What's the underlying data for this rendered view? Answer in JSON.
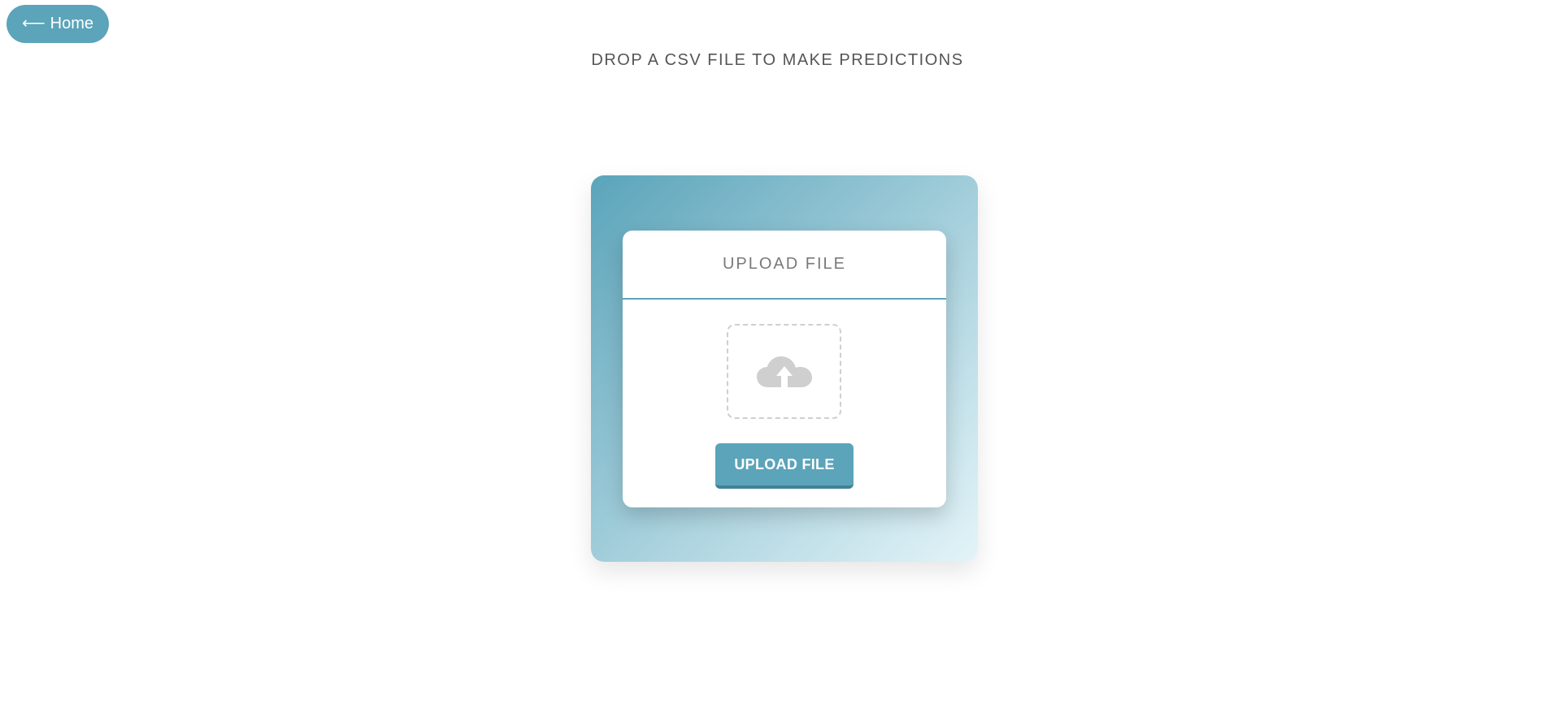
{
  "nav": {
    "home_label": "Home",
    "home_arrow": "⟵"
  },
  "page": {
    "title": "DROP A CSV FILE TO MAKE PREDICTIONS"
  },
  "upload_card": {
    "title": "UPLOAD FILE",
    "drop_icon": "cloud-upload-icon",
    "button_label": "UPLOAD FILE"
  },
  "colors": {
    "accent": "#5ba4ba",
    "accent_dark": "#3f8298",
    "panel_gradient_start": "#5ba4ba",
    "panel_gradient_end": "#e3f4f8",
    "icon_gray": "#cfcfcf",
    "text_gray": "#555555"
  }
}
